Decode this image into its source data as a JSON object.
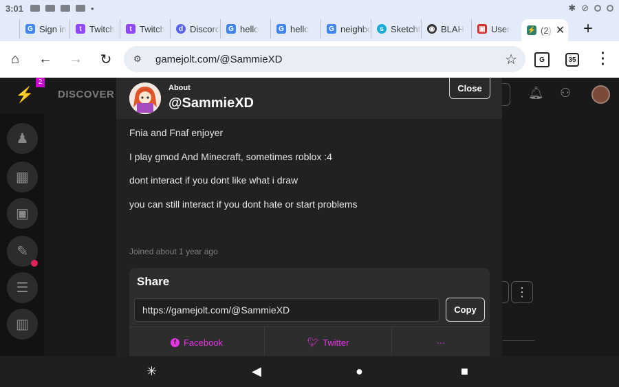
{
  "status_bar": {
    "time": "3:01"
  },
  "tabs": [
    {
      "label": "Sign in",
      "favicon": "google-icon",
      "color": "#4285f4",
      "glyph": "G"
    },
    {
      "label": "Twitch",
      "favicon": "twitch-icon",
      "color": "#9146ff",
      "glyph": "t"
    },
    {
      "label": "Twitch",
      "favicon": "twitch-icon",
      "color": "#9146ff",
      "glyph": "t"
    },
    {
      "label": "Discord",
      "favicon": "discord-icon",
      "color": "#5865f2",
      "glyph": "d"
    },
    {
      "label": "hello",
      "favicon": "google-icon",
      "color": "#4285f4",
      "glyph": "G"
    },
    {
      "label": "hello",
      "favicon": "google-icon",
      "color": "#4285f4",
      "glyph": "G"
    },
    {
      "label": "neighbor",
      "favicon": "google-icon",
      "color": "#4285f4",
      "glyph": "G"
    },
    {
      "label": "Sketchfab",
      "favicon": "sketchfab-icon",
      "color": "#1caad9",
      "glyph": "s"
    },
    {
      "label": "BLAH",
      "favicon": "globe-icon",
      "color": "#333333",
      "glyph": "◉"
    },
    {
      "label": "User",
      "favicon": "scratch-icon",
      "color": "#d32f2f",
      "glyph": "▣"
    }
  ],
  "active_tab": {
    "label": "(2)",
    "favicon": "gamejolt-icon"
  },
  "address_bar": {
    "url": "gamejolt.com/@SammieXD",
    "tab_count": "35"
  },
  "page_behind": {
    "discover": "DISCOVER",
    "notif_count": "2"
  },
  "modal": {
    "about_label": "About",
    "username": "@SammieXD",
    "close_label": "Close",
    "bio": [
      "Fnia and Fnaf enjoyer",
      "I play gmod And Minecraft, sometimes roblox :4",
      "dont interact if you dont like what i draw",
      "you can still interact if you dont hate or start problems"
    ],
    "joined": "Joined about 1 year ago",
    "share": {
      "title": "Share",
      "link": "https://gamejolt.com/@SammieXD",
      "copy_label": "Copy",
      "facebook_label": "Facebook",
      "twitter_label": "Twitter",
      "more_label": "···"
    }
  },
  "colors": {
    "accent": "#e535e5",
    "modal_bg": "#212121"
  }
}
